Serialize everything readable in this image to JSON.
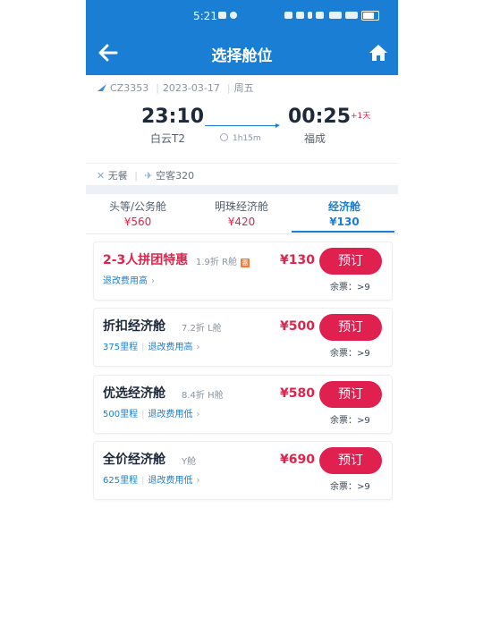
{
  "status_bar": {
    "time": "5:21"
  },
  "header": {
    "title": "选择舱位"
  },
  "flight": {
    "flight_no": "CZ3353",
    "date": "2023-03-17",
    "weekday": "周五",
    "dep_time": "23:10",
    "dep_airport": "白云T2",
    "arr_time": "00:25",
    "arr_day_offset": "+1天",
    "arr_airport": "福成",
    "duration": "1h15m",
    "meal": "无餐",
    "aircraft": "空客320"
  },
  "tabs": [
    {
      "name": "头等/公务舱",
      "price": "¥560"
    },
    {
      "name": "明珠经济舱",
      "price": "¥420"
    },
    {
      "name": "经济舱",
      "price": "¥130"
    }
  ],
  "fares": [
    {
      "name": "2-3人拼团特惠",
      "discount": "1.9折",
      "cabin": "R舱",
      "badge": "惠",
      "mileage": "",
      "refund": "退改费用高",
      "price": "¥130",
      "book": "预订",
      "remain_label": "余票：",
      "remain": ">9"
    },
    {
      "name": "折扣经济舱",
      "discount": "7.2折",
      "cabin": "L舱",
      "mileage": "375里程",
      "refund": "退改费用高",
      "price": "¥500",
      "book": "预订",
      "remain_label": "余票：",
      "remain": ">9"
    },
    {
      "name": "优选经济舱",
      "discount": "8.4折",
      "cabin": "H舱",
      "mileage": "500里程",
      "refund": "退改费用低",
      "price": "¥580",
      "book": "预订",
      "remain_label": "余票：",
      "remain": ">9"
    },
    {
      "name": "全价经济舱",
      "discount": "",
      "cabin": "Y舱",
      "mileage": "625里程",
      "refund": "退改费用低",
      "price": "¥690",
      "book": "预订",
      "remain_label": "余票：",
      "remain": ">9"
    }
  ],
  "colors": {
    "primary": "#1a7fd4",
    "accent": "#e0234b"
  }
}
